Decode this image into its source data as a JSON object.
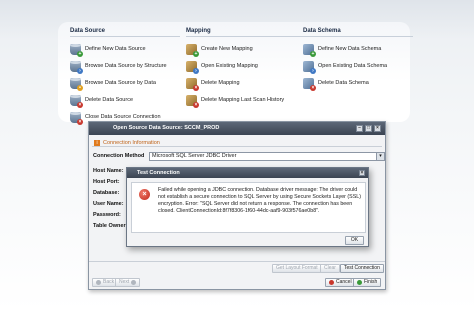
{
  "menu": {
    "columns": [
      {
        "title": "Data Source",
        "items": [
          {
            "label": "Define New Data Source",
            "icon": "database-add-icon"
          },
          {
            "label": "Browse Data Source by Structure",
            "icon": "database-browse-icon"
          },
          {
            "label": "Browse Data Source by Data",
            "icon": "database-search-icon"
          },
          {
            "label": "Delete Data Source",
            "icon": "database-delete-icon"
          },
          {
            "label": "Close Data Source Connection",
            "icon": "database-close-icon"
          }
        ]
      },
      {
        "title": "Mapping",
        "items": [
          {
            "label": "Create New Mapping",
            "icon": "mapping-add-icon"
          },
          {
            "label": "Open Existing Mapping",
            "icon": "mapping-open-icon"
          },
          {
            "label": "Delete Mapping",
            "icon": "mapping-delete-icon"
          },
          {
            "label": "Delete Mapping Last Scan History",
            "icon": "mapping-history-delete-icon"
          }
        ]
      },
      {
        "title": "Data Schema",
        "items": [
          {
            "label": "Define New Data Schema",
            "icon": "schema-add-icon"
          },
          {
            "label": "Open Existing Data Schema",
            "icon": "schema-open-icon"
          },
          {
            "label": "Delete Data Schema",
            "icon": "schema-delete-icon"
          }
        ]
      }
    ]
  },
  "main_dialog": {
    "title": "Open Source Data Source: SCCM_PROD",
    "section_title": "Connection Information",
    "section_icon": "info-icon",
    "method_label": "Connection Method",
    "method_value": "Microsoft SQL Server JDBC Driver",
    "fields": [
      "Host Name:",
      "Host Port:",
      "Database:",
      "User Name:",
      "Password:",
      "Table Owner:"
    ],
    "buttons": {
      "get_layout": "Get Layout Format",
      "clear": "Clear",
      "test": "Test Connection",
      "back": "Back",
      "next": "Next",
      "cancel": "Cancel",
      "finish": "Finish"
    }
  },
  "error_dialog": {
    "title": "Test Connection",
    "message": "Failed while opening a JDBC connection. Database driver message: The driver could not establish a secure connection to SQL Server by using Secure Sockets Layer (SSL) encryption. Error: \"SQL Server did not return a response. The connection has been closed. ClientConnectionId:8f7f8306-1f60-44dc-aaf9-903f576ae0b8\".",
    "ok_label": "OK",
    "icon": "error-icon"
  },
  "colors": {
    "title_bar": "#3b4452",
    "accent_orange": "#e07b1e",
    "error_red": "#c0281c"
  }
}
